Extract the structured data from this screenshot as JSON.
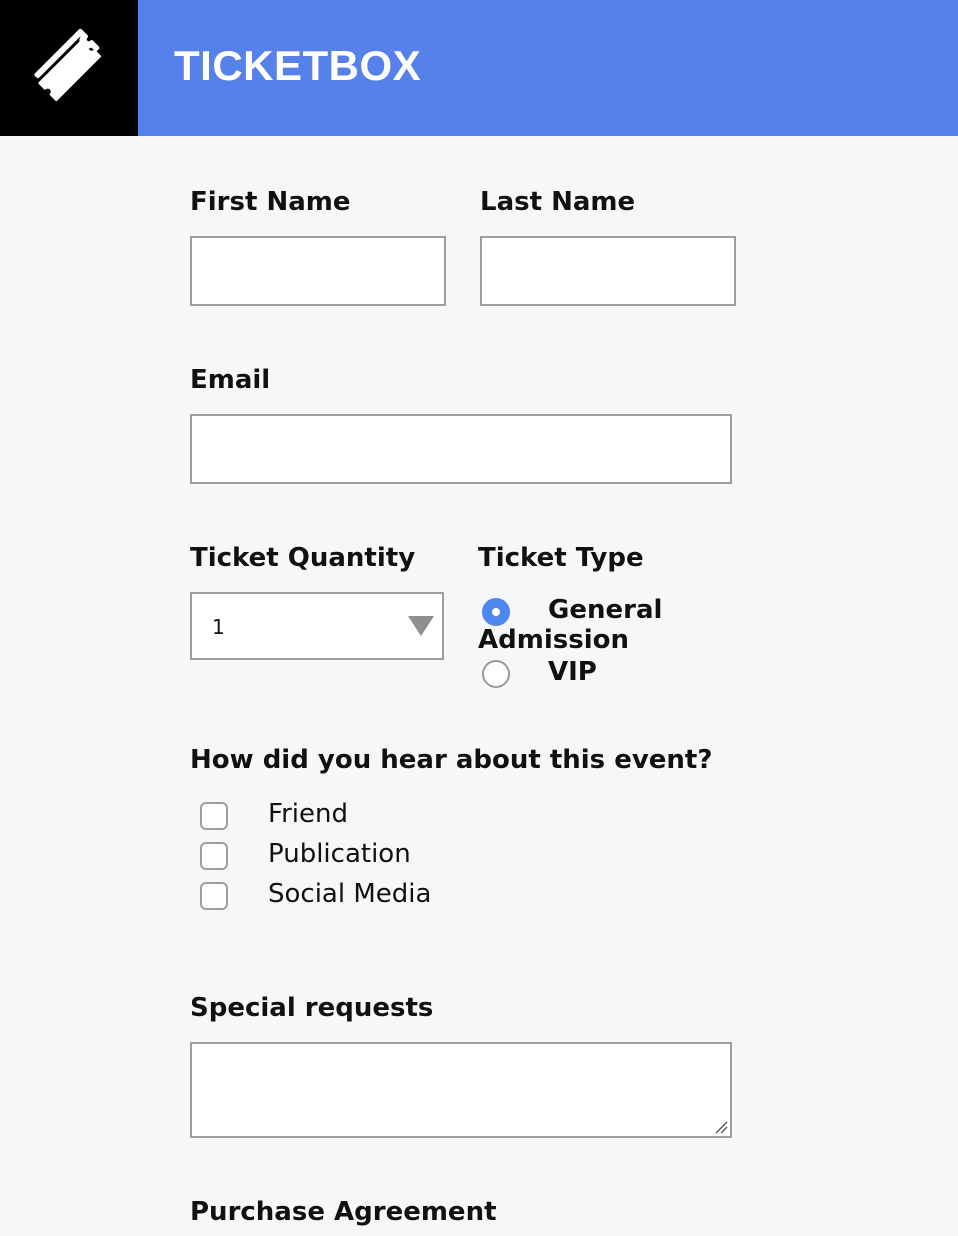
{
  "header": {
    "brand": "TICKETBOX",
    "logo_icon": "ticket-icon",
    "background_color": "#5680ea",
    "logo_background_color": "#000000"
  },
  "form": {
    "first_name": {
      "label": "First Name",
      "value": "",
      "placeholder": ""
    },
    "last_name": {
      "label": "Last Name",
      "value": "",
      "placeholder": ""
    },
    "email": {
      "label": "Email",
      "value": "",
      "placeholder": ""
    },
    "ticket_quantity": {
      "label": "Ticket Quantity",
      "selected": "1"
    },
    "ticket_type": {
      "label": "Ticket Type",
      "options": [
        {
          "label_line1": "General",
          "label_line2": "Admission",
          "checked": true
        },
        {
          "label": "VIP",
          "checked": false
        }
      ]
    },
    "referral": {
      "label": "How did you hear about this event?",
      "options": [
        {
          "label": "Friend",
          "checked": false
        },
        {
          "label": "Publication",
          "checked": false
        },
        {
          "label": "Social Media",
          "checked": false
        }
      ]
    },
    "special_requests": {
      "label": "Special requests",
      "value": ""
    },
    "purchase_agreement": {
      "label": "Purchase Agreement"
    }
  },
  "colors": {
    "accent": "#4f86f0",
    "page_background": "#f7f7f7",
    "field_border": "#9e9e9e"
  }
}
